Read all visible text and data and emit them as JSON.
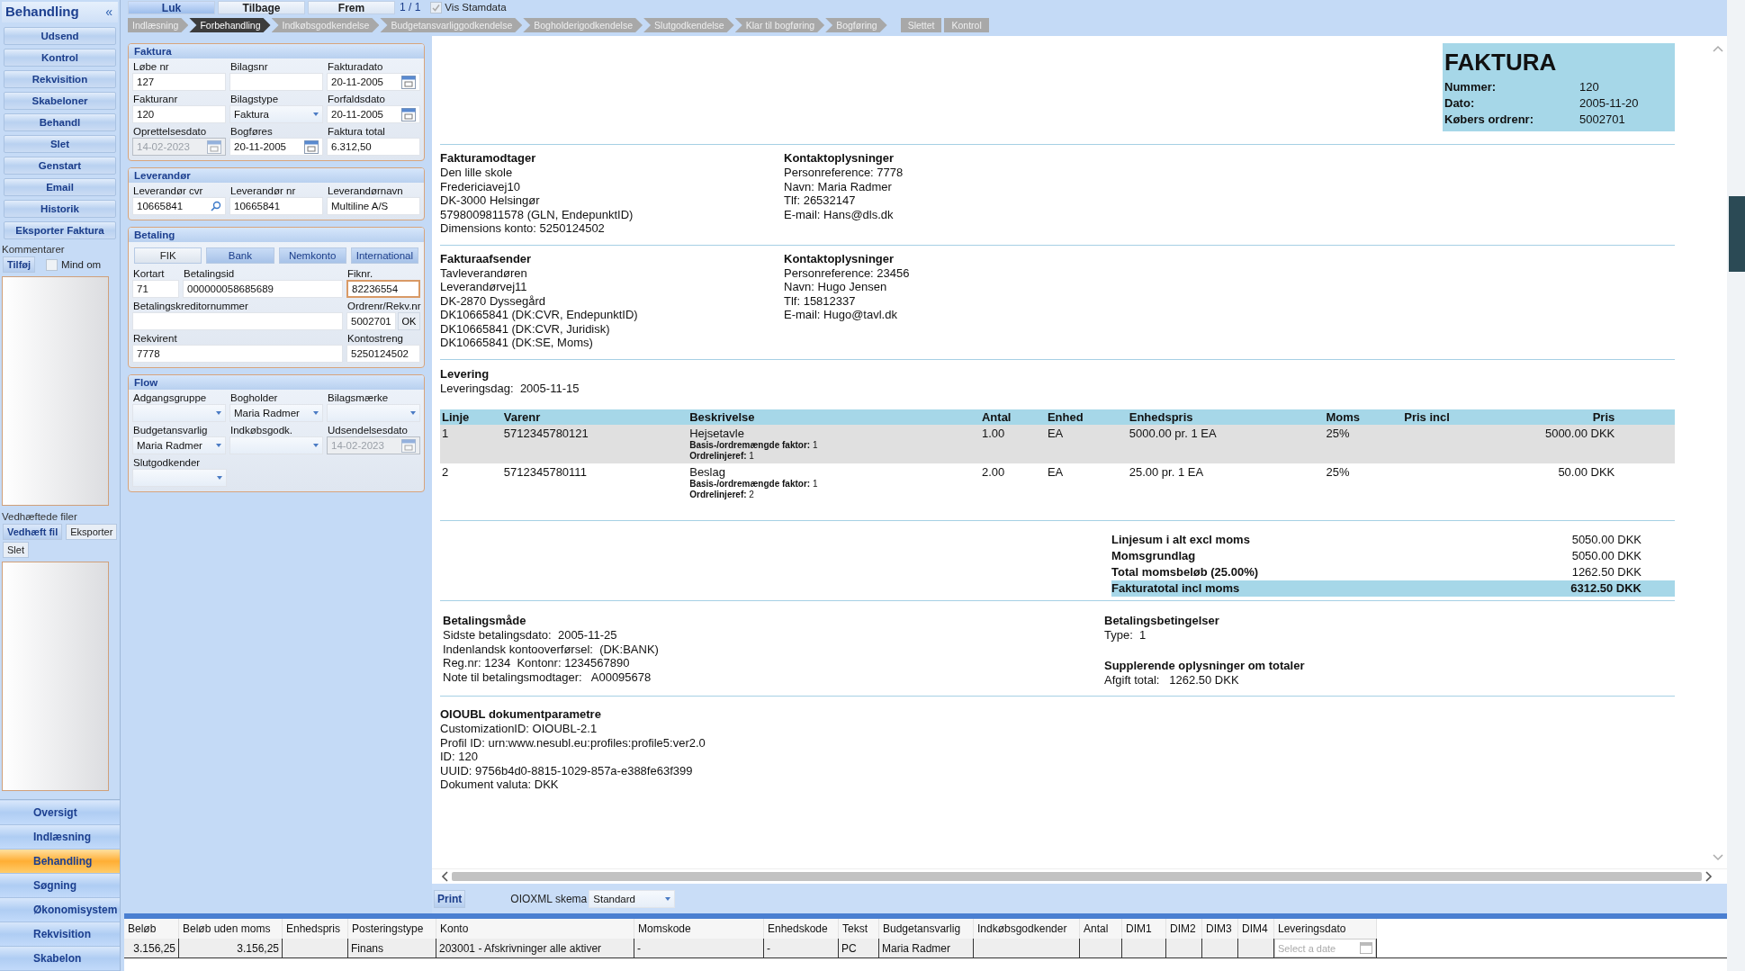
{
  "sidebar": {
    "title": "Behandling",
    "collapse": "«",
    "actions": [
      "Udsend",
      "Kontrol",
      "Rekvisition",
      "Skabeloner",
      "Behandl",
      "Slet",
      "Genstart",
      "Email",
      "Historik",
      "Eksporter Faktura"
    ],
    "comments_label": "Kommentarer",
    "add_button": "Tilføj",
    "remind": {
      "label": "Mind om",
      "checked": false
    },
    "attachments_label": "Vedhæftede filer",
    "attach_buttons": [
      "Vedhæft fil",
      "Eksporter"
    ],
    "delete_button": "Slet",
    "nav": [
      {
        "label": "Oversigt",
        "selected": false
      },
      {
        "label": "Indlæsning",
        "selected": false
      },
      {
        "label": "Behandling",
        "selected": true
      },
      {
        "label": "Søgning",
        "selected": false
      },
      {
        "label": "Økonomisystem",
        "selected": false
      },
      {
        "label": "Rekvisition",
        "selected": false
      },
      {
        "label": "Skabelon",
        "selected": false
      }
    ]
  },
  "toolbar": {
    "buttons": [
      {
        "label": "Luk",
        "selected": true
      },
      {
        "label": "Tilbage",
        "selected": false
      },
      {
        "label": "Frem",
        "selected": false
      }
    ],
    "counter": "1 / 1",
    "vis_stamdata": {
      "label": "Vis Stamdata",
      "checked": true
    }
  },
  "workflow": {
    "steps": [
      {
        "label": "Indlæsning",
        "selected": false
      },
      {
        "label": "Forbehandling",
        "selected": true
      },
      {
        "label": "Indkøbsgodkendelse",
        "selected": false
      },
      {
        "label": "Budgetansvarliggodkendelse",
        "selected": false
      },
      {
        "label": "Bogholderigodkendelse",
        "selected": false
      },
      {
        "label": "Slutgodkendelse",
        "selected": false
      },
      {
        "label": "Klar til bogføring",
        "selected": false
      },
      {
        "label": "Bogføring",
        "selected": false
      }
    ],
    "extra": [
      "Slettet",
      "Kontrol"
    ]
  },
  "form": [
    {
      "title": "Faktura",
      "rows": [
        [
          {
            "label": "Løbe nr",
            "value": "127",
            "kind": "text",
            "disabled": false,
            "focused": false
          },
          {
            "label": "Bilagsnr",
            "kind": "text",
            "disabled": false,
            "focused": false
          },
          {
            "label": "Fakturadato",
            "value": "20-11-2005",
            "kind": "date",
            "disabled": false,
            "focused": false
          }
        ],
        [
          {
            "label": "Fakturanr",
            "value": "120",
            "kind": "text",
            "disabled": false,
            "focused": false
          },
          {
            "label": "Bilagstype",
            "value": "Faktura",
            "kind": "select",
            "disabled": false,
            "focused": false
          },
          {
            "label": "Forfaldsdato",
            "value": "20-11-2005",
            "kind": "date",
            "disabled": false,
            "focused": false
          }
        ],
        [
          {
            "label": "Oprettelsesdato",
            "value": "14-02-2023",
            "kind": "date",
            "disabled": true,
            "focused": false
          },
          {
            "label": "Bogføres",
            "value": "20-11-2005",
            "kind": "date",
            "disabled": false,
            "focused": false
          },
          {
            "label": "Faktura total",
            "value": "6.312,50",
            "kind": "text",
            "disabled": false,
            "focused": false
          }
        ]
      ]
    },
    {
      "title": "Leverandør",
      "rows": [
        [
          {
            "label": "Leverandør cvr",
            "value": "10665841",
            "kind": "search",
            "disabled": false,
            "focused": false
          },
          {
            "label": "Leverandør nr",
            "value": "10665841",
            "kind": "text",
            "disabled": false,
            "focused": false
          },
          {
            "label": "Leverandørnavn",
            "value": "Multiline A/S",
            "kind": "text",
            "disabled": false,
            "focused": false
          }
        ]
      ]
    },
    {
      "title": "Betaling",
      "tabs": [
        {
          "label": "FIK",
          "selected": true
        },
        {
          "label": "Bank",
          "selected": false
        },
        {
          "label": "Nemkonto",
          "selected": false
        },
        {
          "label": "International",
          "selected": false
        }
      ],
      "rows": [
        [
          {
            "label": "Kortart",
            "value": "71",
            "kind": "text",
            "disabled": false,
            "focused": false
          },
          {
            "label": "Betalingsid",
            "value": "000000058685689",
            "kind": "text",
            "disabled": false,
            "focused": false
          },
          {
            "label": "Fiknr.",
            "value": "82236554",
            "kind": "text",
            "disabled": false,
            "focused": true
          }
        ],
        [
          {
            "label": "Betalingskreditornummer",
            "kind": "text",
            "disabled": false,
            "focused": false
          },
          {
            "label": "Ordrenr/Rekv.nr",
            "value": "5002701",
            "kind": "button",
            "button": "OK",
            "disabled": false,
            "focused": false
          }
        ],
        [
          {
            "label": "Rekvirent",
            "value": "7778",
            "kind": "text",
            "disabled": false,
            "focused": false
          },
          {
            "label": "Kontostreng",
            "value": "5250124502",
            "kind": "text",
            "disabled": false,
            "focused": false
          }
        ]
      ]
    },
    {
      "title": "Flow",
      "rows": [
        [
          {
            "label": "Adgangsgruppe",
            "kind": "select",
            "disabled": false,
            "focused": false
          },
          {
            "label": "Bogholder",
            "value": "Maria Radmer",
            "kind": "select",
            "disabled": false,
            "focused": false
          },
          {
            "label": "Bilagsmærke",
            "kind": "select",
            "disabled": false,
            "focused": false
          }
        ],
        [
          {
            "label": "Budgetansvarlig",
            "value": "Maria Radmer",
            "kind": "select",
            "disabled": false,
            "focused": false
          },
          {
            "label": "Indkøbsgodk.",
            "kind": "select",
            "disabled": false,
            "focused": false
          },
          {
            "label": "Udsendelsesdato",
            "value": "14-02-2023",
            "kind": "date",
            "disabled": true,
            "focused": false
          }
        ],
        [
          {
            "label": "Slutgodkender",
            "kind": "select",
            "disabled": false,
            "focused": false
          }
        ]
      ]
    }
  ],
  "invoice": {
    "title": "FAKTURA",
    "meta": [
      {
        "label": "Nummer:",
        "value": "120"
      },
      {
        "label": "Dato:",
        "value": "2005-11-20"
      },
      {
        "label": "Købers ordrenr:",
        "value": "5002701"
      }
    ],
    "parties": [
      {
        "heading": "Fakturamodtager",
        "lines": [
          "Den lille skole",
          "Fredericiavej10",
          "DK-3000 Helsingør",
          "5798009811578 (GLN, EndepunktID)",
          "Dimensions konto: 5250124502"
        ],
        "contact_heading": "Kontaktoplysninger",
        "contact": [
          "Personreference: 7778",
          "Navn: Maria Radmer",
          "Tlf: 26532147",
          "E-mail: Hans@dls.dk"
        ]
      },
      {
        "heading": "Fakturaafsender",
        "lines": [
          "Tavleverandøren",
          "Leverandørvej11",
          "DK-2870 Dyssegård",
          "DK10665841 (DK:CVR, EndepunktID)",
          "DK10665841 (DK:CVR, Juridisk)",
          "DK10665841 (DK:SE, Moms)"
        ],
        "contact_heading": "Kontaktoplysninger",
        "contact": [
          "Personreference: 23456",
          "Navn: Hugo Jensen",
          "Tlf: 15812337",
          "E-mail: Hugo@tavl.dk"
        ]
      }
    ],
    "delivery": {
      "heading": "Levering",
      "lines": [
        "Leveringsdag:  2005-11-15"
      ]
    },
    "columns": [
      "Linje",
      "Varenr",
      "Beskrivelse",
      "Antal",
      "Enhed",
      "Enhedspris",
      "Moms",
      "Pris incl",
      "Pris"
    ],
    "lines": [
      {
        "linje": "1",
        "varenr": "5712345780121",
        "beskrivelse": "Hejsetavle",
        "details": [
          "**Basis-/ordremængde faktor:** 1",
          "**Ordrelinjeref:** 1"
        ],
        "antal": "1.00",
        "enhed": "EA",
        "enhedspris": "5000.00 pr. 1 EA",
        "moms": "25%",
        "pris": "5000.00 DKK"
      },
      {
        "linje": "2",
        "varenr": "5712345780111",
        "beskrivelse": "Beslag",
        "details": [
          "**Basis-/ordremængde faktor:** 1",
          "**Ordrelinjeref:** 2"
        ],
        "antal": "2.00",
        "enhed": "EA",
        "enhedspris": "25.00 pr. 1 EA",
        "moms": "25%",
        "pris": "50.00 DKK"
      }
    ],
    "totals": [
      {
        "label": "Linjesum i alt excl moms",
        "value": "5050.00 DKK",
        "highlight": false
      },
      {
        "label": "Momsgrundlag",
        "value": "5050.00 DKK",
        "highlight": false
      },
      {
        "label": "Total momsbeløb (25.00%)",
        "value": "1262.50 DKK",
        "highlight": false
      },
      {
        "label": "Fakturatotal incl moms",
        "value": "6312.50 DKK",
        "highlight": true
      }
    ],
    "payment": {
      "heading": "Betalingsmåde",
      "lines": [
        "Sidste betalingsdato:  2005-11-25",
        "Indenlandsk kontooverførsel:  (DK:BANK)",
        "Reg.nr: 1234  Kontonr: 1234567890",
        "Note til betalingsmodtager:   A00095678"
      ]
    },
    "terms": [
      {
        "heading": "Betalingsbetingelser",
        "lines": [
          "Type:  1"
        ]
      },
      {
        "heading": "Supplerende oplysninger om totaler",
        "lines": [
          "Afgift total:   1262.50 DKK"
        ]
      }
    ],
    "oioubl": {
      "heading": "OIOUBL dokumentparametre",
      "lines": [
        "CustomizationID: OIOUBL-2.1",
        "Profil ID: urn:www.nesubl.eu:profiles:profile5:ver2.0",
        "ID: 120",
        "UUID: 9756b4d0-8815-1029-857a-e388fe63f399",
        "Dokument valuta: DKK"
      ]
    }
  },
  "print_bar": {
    "print_button": "Print",
    "schema_label": "OIOXML skema",
    "schema_value": "Standard"
  },
  "grid": {
    "columns": [
      "Beløb",
      "Beløb uden moms",
      "Enhedspris",
      "Posteringstype",
      "Konto",
      "Momskode",
      "Enhedskode",
      "Tekst",
      "Budgetansvarlig",
      "Indkøbsgodkender",
      "Antal",
      "DIM1",
      "DIM2",
      "DIM3",
      "DIM4",
      "Leveringsdato"
    ],
    "row": {
      "belob": "3.156,25",
      "belob_uden_moms": "3.156,25",
      "posteringstype": "Finans",
      "konto": "203001 - Afskrivninger alle aktiver",
      "momskode": "-",
      "enhedskode": "-",
      "tekst": "PC",
      "budgetansvarlig": "Maria Radmer"
    },
    "date_placeholder": "Select a date"
  }
}
